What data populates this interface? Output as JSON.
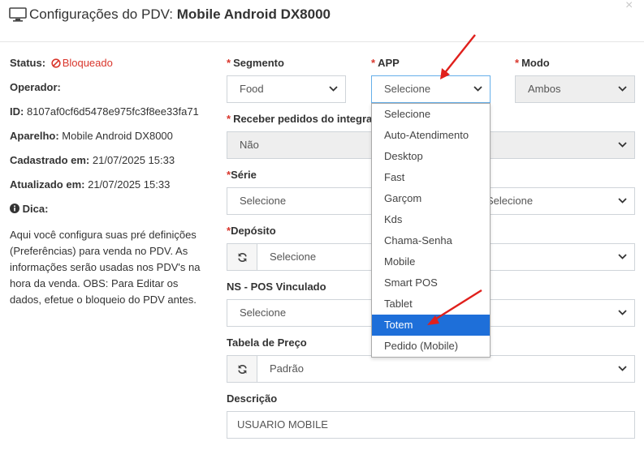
{
  "header": {
    "title_prefix": "Configurações do PDV:",
    "title_device": "Mobile Android DX8000"
  },
  "close_label": "×",
  "info": {
    "status_label": "Status:",
    "status_value": "Bloqueado",
    "operador_label": "Operador:",
    "id_label": "ID:",
    "id_value": "8107af0cf6d5478e975fc3f8ee33fa71",
    "aparelho_label": "Aparelho:",
    "aparelho_value": "Mobile Android DX8000",
    "cadastrado_label": "Cadastrado em:",
    "cadastrado_value": "21/07/2025 15:33",
    "atualizado_label": "Atualizado em:",
    "atualizado_value": "21/07/2025 15:33",
    "dica_label": "Dica:",
    "dica_text": "Aqui você configura suas pré definições (Preferências) para venda no PDV. As informações serão usadas nos PDV's na hora da venda. OBS: Para Editar os dados, efetue o bloqueio do PDV antes."
  },
  "form": {
    "segmento": {
      "label": "Segmento",
      "value": "Food"
    },
    "app": {
      "label": "APP",
      "value": "Selecione"
    },
    "modo": {
      "label": "Modo",
      "value": "Ambos"
    },
    "receber": {
      "label": "Receber pedidos do integra",
      "value": "Não"
    },
    "serie": {
      "label": "Série",
      "value": "Selecione",
      "value2": "Selecione"
    },
    "deposito": {
      "label": "Depósito",
      "value": "Selecione"
    },
    "ns_pos": {
      "label": "NS - POS Vinculado",
      "value": "Selecione"
    },
    "tabela": {
      "label": "Tabela de Preço",
      "value": "Padrão"
    },
    "descricao": {
      "label": "Descrição",
      "value": "USUARIO MOBILE"
    }
  },
  "app_options": [
    "Selecione",
    "Auto-Atendimento",
    "Desktop",
    "Fast",
    "Garçom",
    "Kds",
    "Chama-Senha",
    "Mobile",
    "Smart POS",
    "Tablet",
    "Totem",
    "Pedido (Mobile)"
  ],
  "app_highlighted": "Totem",
  "colors": {
    "required": "#d9362c",
    "highlight": "#1e6fd9",
    "annotation_arrow": "#e0201c"
  }
}
